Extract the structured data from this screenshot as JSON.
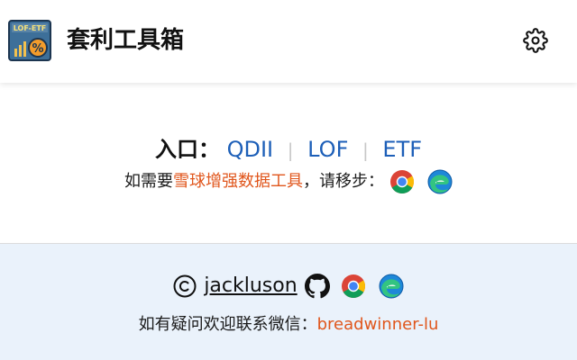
{
  "header": {
    "logo_text": "LOF-ETF",
    "title": "套利工具箱",
    "settings_icon": "gear-icon"
  },
  "main": {
    "entry_label": "入口：",
    "links": [
      {
        "label": "QDII"
      },
      {
        "label": "LOF"
      },
      {
        "label": "ETF"
      }
    ],
    "separator": "|",
    "hint_prefix": "如需要",
    "hint_link": "雪球增强数据工具",
    "hint_suffix": "，请移步：",
    "browsers": [
      "chrome-icon",
      "edge-icon"
    ]
  },
  "footer": {
    "author": "jackluson",
    "icons": [
      "copyright-icon",
      "github-icon",
      "chrome-icon",
      "edge-icon"
    ],
    "contact_prefix": "如有疑问欢迎联系微信：",
    "contact_wechat": "breadwinner-lu"
  },
  "colors": {
    "link_blue": "#1d5fb8",
    "link_orange": "#e0561c",
    "footer_bg": "#eaf2fb"
  }
}
